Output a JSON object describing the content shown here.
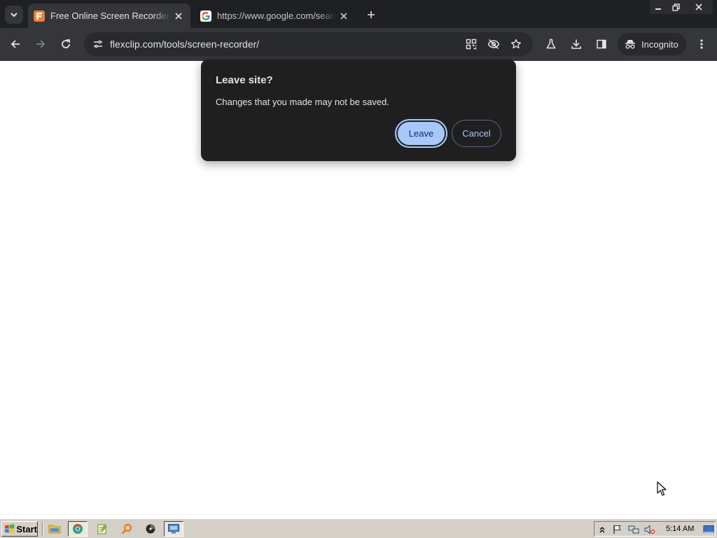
{
  "browser": {
    "tabs": [
      {
        "title": "Free Online Screen Recorder & ",
        "favicon": "flexclip-icon",
        "active": true
      },
      {
        "title": "https://www.google.com/search",
        "favicon": "google-icon",
        "active": false
      }
    ],
    "new_tab_symbol": "+",
    "url": "flexclip.com/tools/screen-recorder/",
    "profile_label": "Incognito"
  },
  "dialog": {
    "title": "Leave site?",
    "message": "Changes that you made may not be saved.",
    "leave_label": "Leave",
    "cancel_label": "Cancel"
  },
  "taskbar": {
    "start_label": "Start",
    "clock": "5:14 AM"
  },
  "colors": {
    "tabstrip_bg": "#1f2023",
    "toolbar_bg": "#35363a",
    "dialog_bg": "#1f1f1f",
    "primary_button": "#a8c7fa",
    "taskbar_bg": "#d4d0c8"
  }
}
